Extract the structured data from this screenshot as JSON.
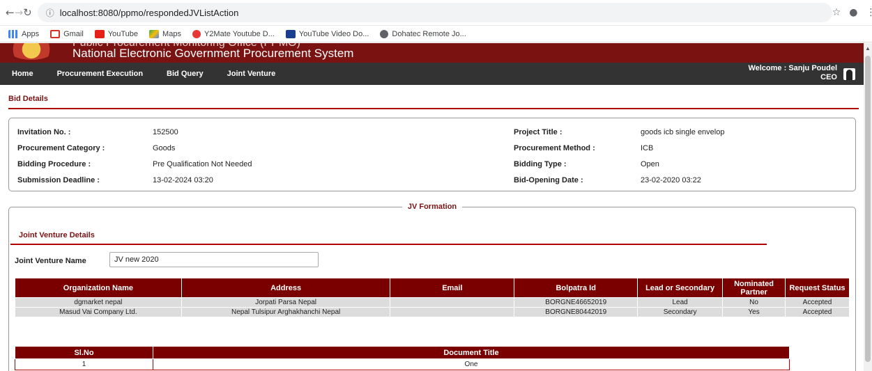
{
  "browser": {
    "url": "localhost:8080/ppmo/respondedJVListAction",
    "bookmarks": [
      "Apps",
      "Gmail",
      "YouTube",
      "Maps",
      "Y2Mate Youtube D...",
      "YouTube Video Do...",
      "Dohatec Remote Jo..."
    ]
  },
  "header": {
    "subtitle": "Public Procurement Monitoring Office (PPMO)",
    "title": "National Electronic Government Procurement System"
  },
  "menu": {
    "items": [
      "Home",
      "Procurement Execution",
      "Bid Query",
      "Joint Venture"
    ],
    "welcome": "Welcome : Sanju Poudel",
    "role": "CEO"
  },
  "bid_details": {
    "heading": "Bid Details",
    "invitation_label": "Invitation No. :",
    "invitation_value": "152500",
    "category_label": "Procurement Category :",
    "category_value": "Goods",
    "procedure_label": "Bidding Procedure :",
    "procedure_value": "Pre Qualification Not Needed",
    "deadline_label": "Submission Deadline :",
    "deadline_value": "13-02-2024 03:20",
    "project_label": "Project Title :",
    "project_value": "goods icb single envelop",
    "method_label": "Procurement Method :",
    "method_value": "ICB",
    "type_label": "Bidding Type :",
    "type_value": "Open",
    "opening_label": "Bid-Opening Date :",
    "opening_value": "23-02-2020 03:22"
  },
  "jv": {
    "legend": "JV Formation",
    "details_heading": "Joint Venture Details",
    "name_label": "Joint Venture Name",
    "name_value": "JV new 2020",
    "columns": [
      "Organization Name",
      "Address",
      "Email",
      "Bolpatra Id",
      "Lead or Secondary",
      "Nominated Partner",
      "Request Status"
    ],
    "rows": [
      [
        "dgmarket nepal",
        "Jorpati Parsa Nepal",
        "",
        "BORGNE46652019",
        "Lead",
        "No",
        "Accepted"
      ],
      [
        "Masud Vai Company Ltd.",
        "Nepal Tulsipur Arghakhanchi Nepal",
        "",
        "BORGNE80442019",
        "Secondary",
        "Yes",
        "Accepted"
      ]
    ],
    "doc_columns": [
      "Sl.No",
      "Document Title"
    ],
    "doc_rows": [
      [
        "1",
        "One"
      ]
    ]
  }
}
